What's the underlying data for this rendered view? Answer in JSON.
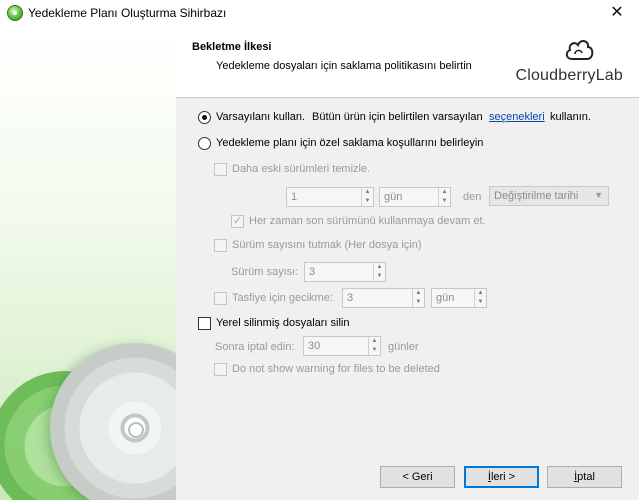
{
  "window": {
    "title": "Yedekleme Planı Oluşturma Sihirbazı",
    "close_glyph": "✕"
  },
  "header": {
    "title": "Bekletme İlkesi",
    "subtitle": "Yedekleme dosyaları için saklama politikasını belirtin",
    "brand": "CloudberryLab"
  },
  "retention": {
    "default_option": {
      "label": "Varsayılanı kullan.",
      "description": "Bütün ürün için belirtilen varsayılan",
      "link": "seçenekleri",
      "suffix": "kullanın.",
      "selected": true
    },
    "custom_option": {
      "label": "Yedekleme planı için özel saklama koşullarını belirleyin",
      "selected": false
    },
    "delete_old": {
      "label": "Daha eski sürümleri temizle.",
      "value": "1",
      "unit": "gün",
      "den_label": "den",
      "date_option": "Değiştirilme tarihi"
    },
    "keep_last": {
      "label": "Her zaman son sürümünü kullanmaya devam et.",
      "checked": true
    },
    "version_count": {
      "label": "Sürüm sayısını tutmak (Her dosya için)",
      "field_label": "Sürüm sayısı:",
      "value": "3"
    },
    "purge_delay": {
      "label": "Tasfiye için gecikme:",
      "value": "3",
      "unit": "gün"
    },
    "delete_local": {
      "label": "Yerel silinmiş dosyaları silin",
      "checked": false,
      "cancel_label": "Sonra iptal edin:",
      "cancel_value": "30",
      "cancel_unit": "günler",
      "no_warning_label": "Do not show warning for files to be deleted"
    }
  },
  "buttons": {
    "back": "< Geri",
    "next_prefix": "İ",
    "next_rest": "leri >",
    "cancel_prefix": "İ",
    "cancel_rest": "ptal"
  }
}
